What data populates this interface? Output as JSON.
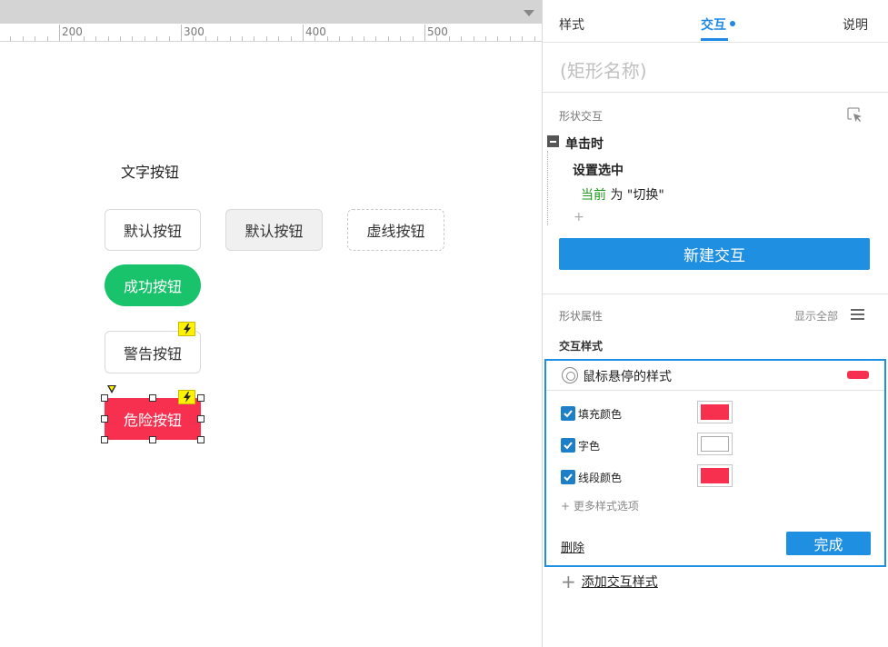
{
  "ruler": {
    "labels": [
      "200",
      "300",
      "400",
      "500"
    ]
  },
  "canvas": {
    "text_button": "文字按钮",
    "default_button_1": "默认按钮",
    "default_button_2": "默认按钮",
    "dashed_button": "虚线按钮",
    "success_button": "成功按钮",
    "warning_button": "警告按钮",
    "danger_button": "危险按钮"
  },
  "tabs": {
    "style": "样式",
    "interaction": "交互",
    "notes": "说明"
  },
  "shape_name_placeholder": "(矩形名称)",
  "shape_interactions": {
    "label": "形状交互",
    "event": "单击时",
    "action": "设置选中",
    "detail_target": "当前",
    "detail_rest": " 为 \"切换\"",
    "add": "+",
    "new_button": "新建交互"
  },
  "shape_properties": {
    "label": "形状属性",
    "show_all": "显示全部",
    "interaction_styles_label": "交互样式"
  },
  "hover_style": {
    "title": "鼠标悬停的样式",
    "swatch_color": "#f7304f",
    "rows": [
      {
        "label": "填充颜色",
        "checked": true,
        "color": "#f7304f"
      },
      {
        "label": "字色",
        "checked": true,
        "color": "#ffffff"
      },
      {
        "label": "线段颜色",
        "checked": true,
        "color": "#f7304f"
      }
    ],
    "more": "+ 更多样式选项",
    "delete": "删除",
    "done": "完成"
  },
  "add_interaction_style": "添加交互样式",
  "colors": {
    "accent": "#1e8fe1",
    "success": "#19c36b",
    "danger": "#f7304f",
    "bolt": "#fff200"
  }
}
